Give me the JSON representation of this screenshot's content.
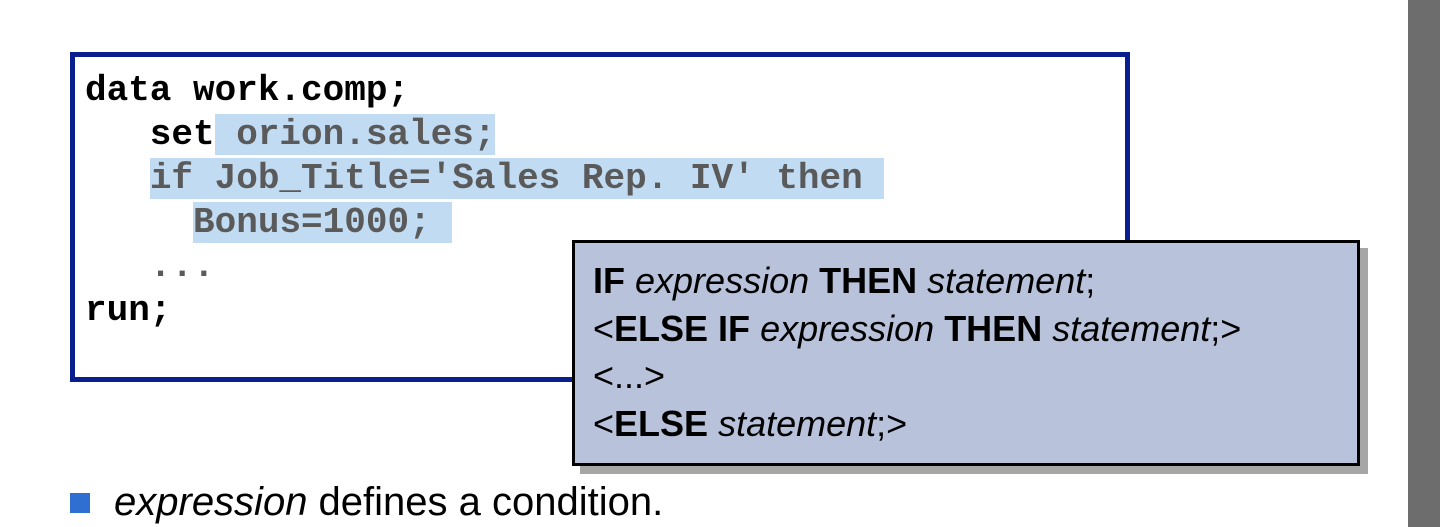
{
  "code": {
    "l1": "data work.comp;",
    "l2_pre": "   set",
    "l2_hl": " orion.sales;",
    "l3_pre": "   ",
    "l3_hl": "if Job_Title='Sales Rep. IV' then ",
    "l4_pre": "     ",
    "l4_hl": "Bonus=1000; ",
    "l5": "   ...",
    "l6": "run;"
  },
  "syntax": {
    "line1": {
      "kw1": "IF",
      "sp1": " ",
      "it1": "expression",
      "sp2": " ",
      "kw2": "THEN",
      "sp3": " ",
      "it2": "statement",
      "tail": ";"
    },
    "line2": {
      "open": "<",
      "kw1": "ELSE IF",
      "sp1": " ",
      "it1": "expression",
      "sp2": " ",
      "kw2": "THEN",
      "sp3": " ",
      "it2": "statement",
      "tail": ";>"
    },
    "line3": "<...>",
    "line4": {
      "open": "<",
      "kw1": "ELSE",
      "sp1": " ",
      "it1": "statement",
      "tail": ";>"
    }
  },
  "bullet": {
    "it": "expression",
    "rest": " defines a condition."
  }
}
